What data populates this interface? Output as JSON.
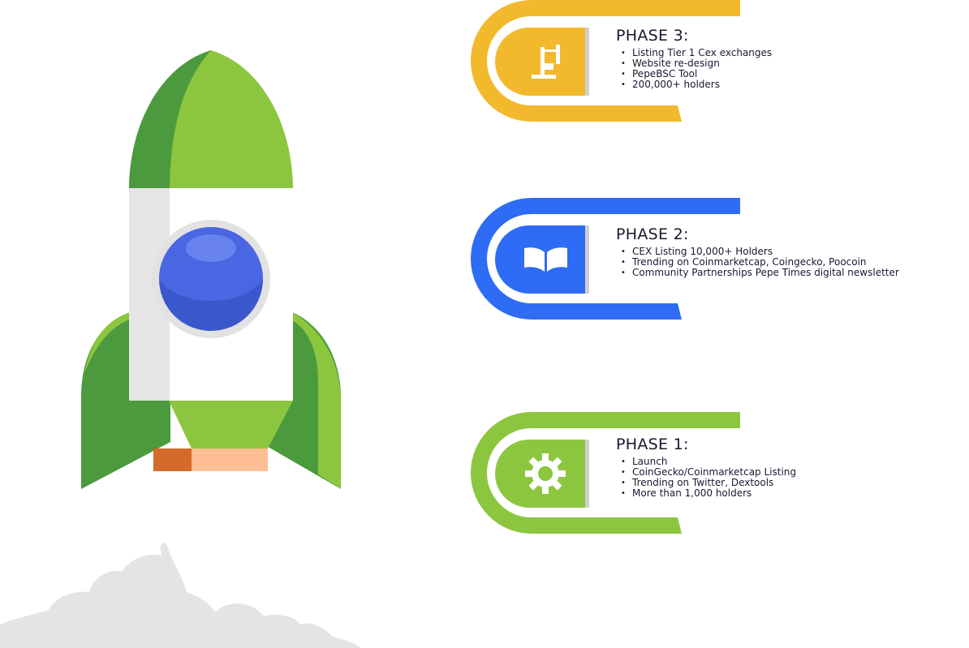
{
  "colors": {
    "rocket_green": "#8cc63f",
    "rocket_dark_green": "#4b9a3e",
    "rocket_body": "#ffffff",
    "rocket_body_shadow": "#e6e6e6",
    "window_blue": "#4863e0",
    "flame_orange": "#d46b2a",
    "flame_peach": "#ffbe93",
    "cloud": "#e4e4e4",
    "phase3": "#f3b92d",
    "phase2": "#2f6cf5",
    "phase1": "#8cc63f"
  },
  "phases": [
    {
      "id": "phase3",
      "title": "PHASE 3:",
      "icon": "flag-icon",
      "items": [
        "Listing Tier 1 Cex exchanges",
        "Website re-design",
        "PepeBSC Tool",
        "200,000+ holders"
      ]
    },
    {
      "id": "phase2",
      "title": "PHASE 2:",
      "icon": "book-icon",
      "items": [
        "CEX Listing 10,000+ Holders",
        "Trending on Coinmarketcap, Coingecko, Poocoin",
        "Community Partnerships Pepe Times digital newsletter"
      ]
    },
    {
      "id": "phase1",
      "title": "PHASE 1:",
      "icon": "gear-icon",
      "items": [
        "Launch",
        "CoinGecko/Coinmarketcap Listing",
        "Trending on Twitter, Dextools",
        "More than 1,000 holders"
      ]
    }
  ]
}
